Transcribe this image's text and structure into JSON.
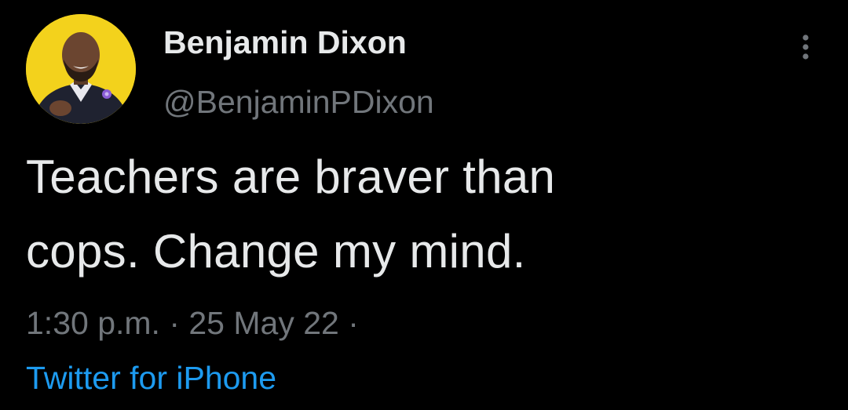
{
  "tweet": {
    "author": {
      "display_name": "Benjamin Dixon",
      "handle": "@BenjaminPDixon",
      "avatar_icon": "profile-photo"
    },
    "text_line1": "Teachers are braver than",
    "text_line2": "cops. Change my mind.",
    "timestamp": "1:30 p.m. · 25 May 22 ·",
    "source": "Twitter for iPhone",
    "more_icon": "more-vertical-icon"
  },
  "colors": {
    "background": "#000000",
    "primary_text": "#e7e9ea",
    "secondary_text": "#71767b",
    "link": "#1d9bf0",
    "avatar_background": "#f3d21c"
  }
}
